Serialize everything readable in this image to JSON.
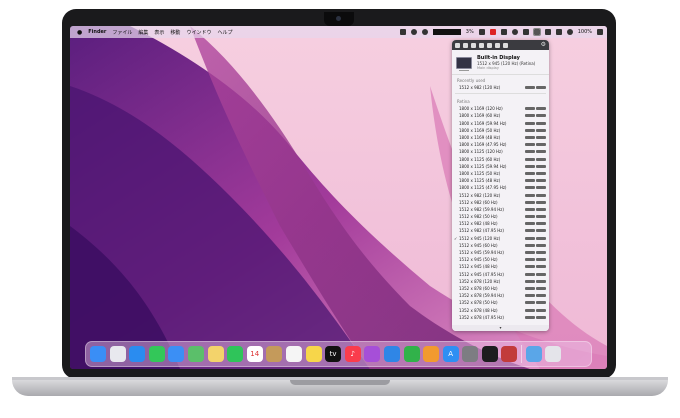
{
  "menubar": {
    "apple_label": "",
    "items": [
      "Finder",
      "ファイル",
      "編集",
      "表示",
      "移動",
      "ウインドウ",
      "ヘルプ"
    ],
    "battery_text": "3%",
    "icons": [
      "dropbox-icon",
      "mic-icon",
      "contrast-icon",
      "stats-icon",
      "red-app-icon",
      "reader-icon",
      "note-icon",
      "bluetooth-icon",
      "volume-icon",
      "display-menu-icon",
      "sort-icon",
      "A-icon",
      "wifi-icon",
      "control-center-icon"
    ],
    "battery_pct": "100%"
  },
  "panel": {
    "toolbar_icons": [
      "display-icon",
      "moon-icon",
      "sun-icon",
      "pencil-icon",
      "window-icon",
      "tablet-icon",
      "gear-icon",
      "power-icon"
    ],
    "display_name": "Built-in Display",
    "display_mode": "1512 x 945 (120 Hz) (Retina)",
    "display_sub": "Main display",
    "recent_label": "Recently used",
    "recent_items": [
      "1512 x 982 (120 Hz)"
    ],
    "retina_label": "Retina",
    "resolutions": [
      "1800 x 1169 (120 Hz)",
      "1800 x 1169 (60 Hz)",
      "1800 x 1169 (59.94 Hz)",
      "1800 x 1169 (50 Hz)",
      "1800 x 1169 (48 Hz)",
      "1800 x 1169 (47.95 Hz)",
      "1800 x 1125 (120 Hz)",
      "1800 x 1125 (60 Hz)",
      "1800 x 1125 (59.94 Hz)",
      "1800 x 1125 (50 Hz)",
      "1800 x 1125 (48 Hz)",
      "1800 x 1125 (47.95 Hz)",
      "1512 x 982 (120 Hz)",
      "1512 x 982 (60 Hz)",
      "1512 x 982 (59.94 Hz)",
      "1512 x 982 (50 Hz)",
      "1512 x 982 (48 Hz)",
      "1512 x 982 (47.95 Hz)",
      "1512 x 945 (120 Hz)",
      "1512 x 945 (60 Hz)",
      "1512 x 945 (59.94 Hz)",
      "1512 x 945 (50 Hz)",
      "1512 x 945 (48 Hz)",
      "1512 x 945 (47.95 Hz)",
      "1352 x 878 (120 Hz)",
      "1352 x 878 (60 Hz)",
      "1352 x 878 (59.94 Hz)",
      "1352 x 878 (50 Hz)",
      "1352 x 878 (48 Hz)",
      "1352 x 878 (47.95 Hz)"
    ],
    "checked_index": 18,
    "scroll_label": "▾"
  },
  "dock": {
    "apps": [
      {
        "name": "finder-icon",
        "color": "#3a8ef6",
        "glyph": ""
      },
      {
        "name": "launchpad-icon",
        "color": "#e8e8ee",
        "glyph": ""
      },
      {
        "name": "safari-icon",
        "color": "#2a8cf0",
        "glyph": ""
      },
      {
        "name": "messages-icon",
        "color": "#33c759",
        "glyph": ""
      },
      {
        "name": "mail-icon",
        "color": "#3b8ff5",
        "glyph": ""
      },
      {
        "name": "maps-icon",
        "color": "#5bbf6a",
        "glyph": ""
      },
      {
        "name": "photos-icon",
        "color": "#f3d36b",
        "glyph": ""
      },
      {
        "name": "facetime-icon",
        "color": "#2fc45a",
        "glyph": ""
      },
      {
        "name": "calendar-icon",
        "color": "#ffffff",
        "glyph": "14"
      },
      {
        "name": "contacts-icon",
        "color": "#c49a5b",
        "glyph": ""
      },
      {
        "name": "reminders-icon",
        "color": "#f5f5f5",
        "glyph": ""
      },
      {
        "name": "notes-icon",
        "color": "#f7d64a",
        "glyph": ""
      },
      {
        "name": "tv-icon",
        "color": "#111111",
        "glyph": "tv"
      },
      {
        "name": "music-icon",
        "color": "#fa3c4c",
        "glyph": "♪"
      },
      {
        "name": "podcasts-icon",
        "color": "#a64fd8",
        "glyph": ""
      },
      {
        "name": "keynote-icon",
        "color": "#2f86e6",
        "glyph": ""
      },
      {
        "name": "numbers-icon",
        "color": "#31b24a",
        "glyph": ""
      },
      {
        "name": "pages-icon",
        "color": "#f29a2e",
        "glyph": ""
      },
      {
        "name": "app-store-icon",
        "color": "#2e8ff3",
        "glyph": "A"
      },
      {
        "name": "system-preferences-icon",
        "color": "#7d7d82",
        "glyph": ""
      },
      {
        "name": "terminal-icon",
        "color": "#1d1d1f",
        "glyph": ""
      },
      {
        "name": "app-icon",
        "color": "#c23b3b",
        "glyph": ""
      }
    ],
    "trailing": [
      {
        "name": "downloads-icon",
        "color": "#5aa6e8",
        "glyph": ""
      },
      {
        "name": "trash-icon",
        "color": "#e4e4ea",
        "glyph": ""
      }
    ]
  }
}
